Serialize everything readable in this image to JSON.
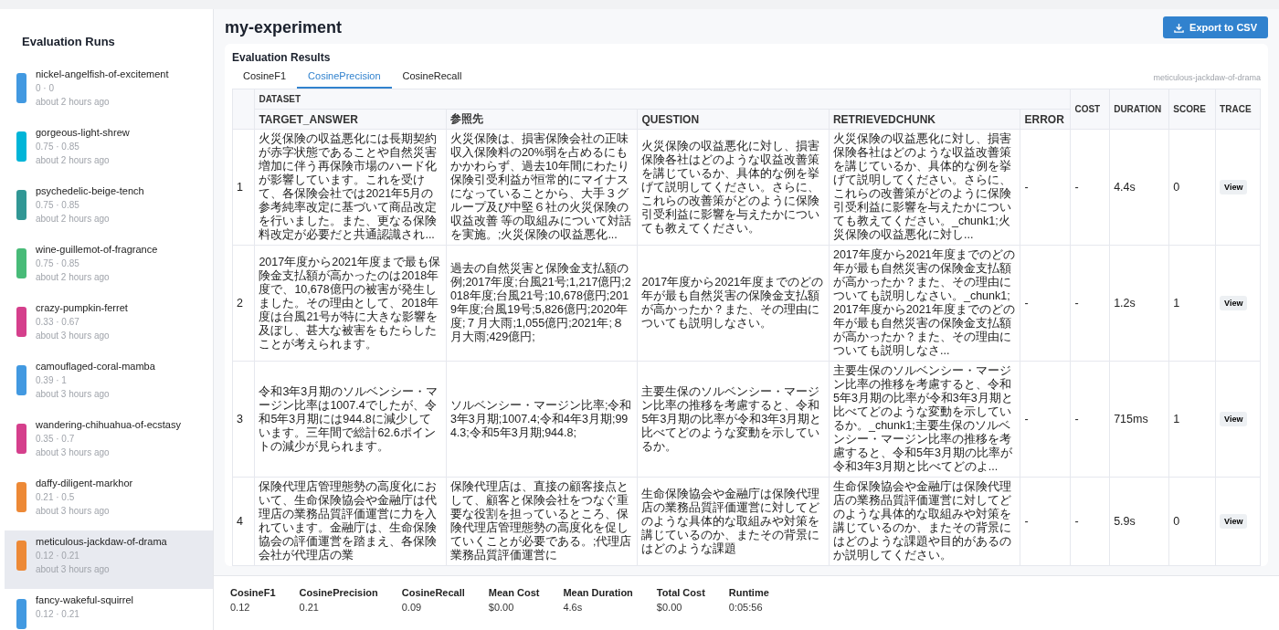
{
  "sidebar": {
    "title": "Evaluation Runs",
    "runs": [
      {
        "name": "nickel-angelfish-of-excitement",
        "scores": "0 · 0",
        "time": "about 2 hours ago",
        "color": "#4299e1",
        "selected": false
      },
      {
        "name": "gorgeous-light-shrew",
        "scores": "0.75 · 0.85",
        "time": "about 2 hours ago",
        "color": "#00b5d8",
        "selected": false
      },
      {
        "name": "psychedelic-beige-tench",
        "scores": "0.75 · 0.85",
        "time": "about 2 hours ago",
        "color": "#319795",
        "selected": false
      },
      {
        "name": "wine-guillemot-of-fragrance",
        "scores": "0.75 · 0.85",
        "time": "about 2 hours ago",
        "color": "#48bb78",
        "selected": false
      },
      {
        "name": "crazy-pumpkin-ferret",
        "scores": "0.33 · 0.67",
        "time": "about 3 hours ago",
        "color": "#d53f8c",
        "selected": false
      },
      {
        "name": "camouflaged-coral-mamba",
        "scores": "0.39 · 1",
        "time": "about 3 hours ago",
        "color": "#4299e1",
        "selected": false
      },
      {
        "name": "wandering-chihuahua-of-ecstasy",
        "scores": "0.35 · 0.7",
        "time": "about 3 hours ago",
        "color": "#d53f8c",
        "selected": false
      },
      {
        "name": "daffy-diligent-markhor",
        "scores": "0.21 · 0.5",
        "time": "about 3 hours ago",
        "color": "#ed8936",
        "selected": false
      },
      {
        "name": "meticulous-jackdaw-of-drama",
        "scores": "0.12 · 0.21",
        "time": "about 3 hours ago",
        "color": "#ed8936",
        "selected": true
      },
      {
        "name": "fancy-wakeful-squirrel",
        "scores": "0.12 · 0.21",
        "color": "#4299e1",
        "selected": false
      }
    ]
  },
  "header": {
    "title": "my-experiment",
    "export_button": "Export to CSV"
  },
  "results": {
    "title": "Evaluation Results",
    "tabs": [
      {
        "label": "CosineF1",
        "selected": false
      },
      {
        "label": "CosinePrecision",
        "selected": true
      },
      {
        "label": "CosineRecall",
        "selected": false
      }
    ],
    "run_label": "meticulous-jackdaw-of-drama",
    "table": {
      "group_header": "DATASET",
      "dataset_columns": [
        "TARGET_ANSWER",
        "参照先",
        "QUESTION",
        "RETRIEVEDCHUNK",
        "ERROR"
      ],
      "other_columns": [
        "COST",
        "DURATION",
        "SCORE",
        "TRACE"
      ],
      "rows": [
        {
          "index": "1",
          "cells": [
            "火災保険の収益悪化には長期契約が赤字状態であることや自然災害増加に伴う再保険市場のハード化が影響しています。これを受けて、各保険会社では2021年5月の参考純率改定に基づいて商品改定を行いました。また、更なる保険料改定が必要だと共通認識され...",
            "火災保険は、損害保険会社の正味収入保険料の20%弱を占めるにもかかわらず、過去10年間にわたり保険引受利益が恒常的にマイナスになっていることから、大手３グループ及び中堅６社の火災保険の収益改善 等の取組みについて対話を実施。;火災保険の収益悪化...",
            "火災保険の収益悪化に対し、損害保険各社はどのような収益改善策を講じているか、具体的な例を挙げて説明してください。さらに、これらの改善策がどのように保険引受利益に影響を与えたかについても教えてください。",
            "火災保険の収益悪化に対し、損害保険各社はどのような収益改善策を講じているか、具体的な例を挙げて説明してください。さらに、これらの改善策がどのように保険引受利益に影響を与えたかについても教えてください。_chunk1;火災保険の収益悪化に対し...",
            "-",
            "-",
            "4.4s",
            "0",
            "View"
          ]
        },
        {
          "index": "2",
          "cells": [
            "2017年度から2021年度まで最も保険金支払額が高かったのは2018年度で、10,678億円の被害が発生しました。その理由として、2018年度は台風21号が特に大きな影響を及ぼし、甚大な被害をもたらしたことが考えられます。",
            "過去の自然災害と保険金支払額の例;2017年度;台風21号;1,217億円;2018年度;台風21号;10,678億円;2019年度;台風19号;5,826億円;2020年度;７月大雨;1,055億円;2021年;８月大雨;429億円;",
            "2017年度から2021年度までのどの年が最も自然災害の保険金支払額が高かったか？また、その理由についても説明しなさい。",
            "2017年度から2021年度までのどの年が最も自然災害の保険金支払額が高かったか？また、その理由についても説明しなさい。_chunk1;2017年度から2021年度までのどの年が最も自然災害の保険金支払額が高かったか？また、その理由についても説明しなさ...",
            "-",
            "-",
            "1.2s",
            "1",
            "View"
          ]
        },
        {
          "index": "3",
          "cells": [
            "令和3年3月期のソルベンシー・マージン比率は1007.4でしたが、令和5年3月期には944.8に減少しています。三年間で総計62.6ポイントの減少が見られます。",
            "ソルベンシー・マージン比率;令和3年3月期;1007.4;令和4年3月期;994.3;令和5年3月期;944.8;",
            "主要生保のソルベンシー・マージン比率の推移を考慮すると、令和5年3月期の比率が令和3年3月期と比べてどのような変動を示しているか。",
            "主要生保のソルベンシー・マージン比率の推移を考慮すると、令和5年3月期の比率が令和3年3月期と比べてどのような変動を示しているか。_chunk1;主要生保のソルベンシー・マージン比率の推移を考慮すると、令和5年3月期の比率が令和3年3月期と比べてどのよ...",
            "-",
            "-",
            "715ms",
            "1",
            "View"
          ]
        },
        {
          "index": "4",
          "cells": [
            "保険代理店管理態勢の高度化において、生命保険協会や金融庁は代理店の業務品質評価運営に力を入れています。金融庁は、生命保険協会の評価運営を踏まえ、各保険会社が代理店の業",
            "保険代理店は、直接の顧客接点として、顧客と保険会社をつなぐ重要な役割を担っているところ、保険代理店管理態勢の高度化を促していくことが必要である。;代理店業務品質評価運営に",
            "生命保険協会や金融庁は保険代理店の業務品質評価運営に対してどのような具体的な取組みや対策を講じているのか、またその背景にはどのような課題",
            "生命保険協会や金融庁は保険代理店の業務品質評価運営に対してどのような具体的な取組みや対策を講じているのか、またその背景にはどのような課題や目的があるのか説明してください。",
            "-",
            "-",
            "5.9s",
            "0",
            "View"
          ]
        }
      ]
    }
  },
  "summary": [
    {
      "label": "CosineF1",
      "value": "0.12"
    },
    {
      "label": "CosinePrecision",
      "value": "0.21"
    },
    {
      "label": "CosineRecall",
      "value": "0.09"
    },
    {
      "label": "Mean Cost",
      "value": "$0.00"
    },
    {
      "label": "Mean Duration",
      "value": "4.6s"
    },
    {
      "label": "Total Cost",
      "value": "$0.00"
    },
    {
      "label": "Runtime",
      "value": "0:05:56"
    }
  ]
}
